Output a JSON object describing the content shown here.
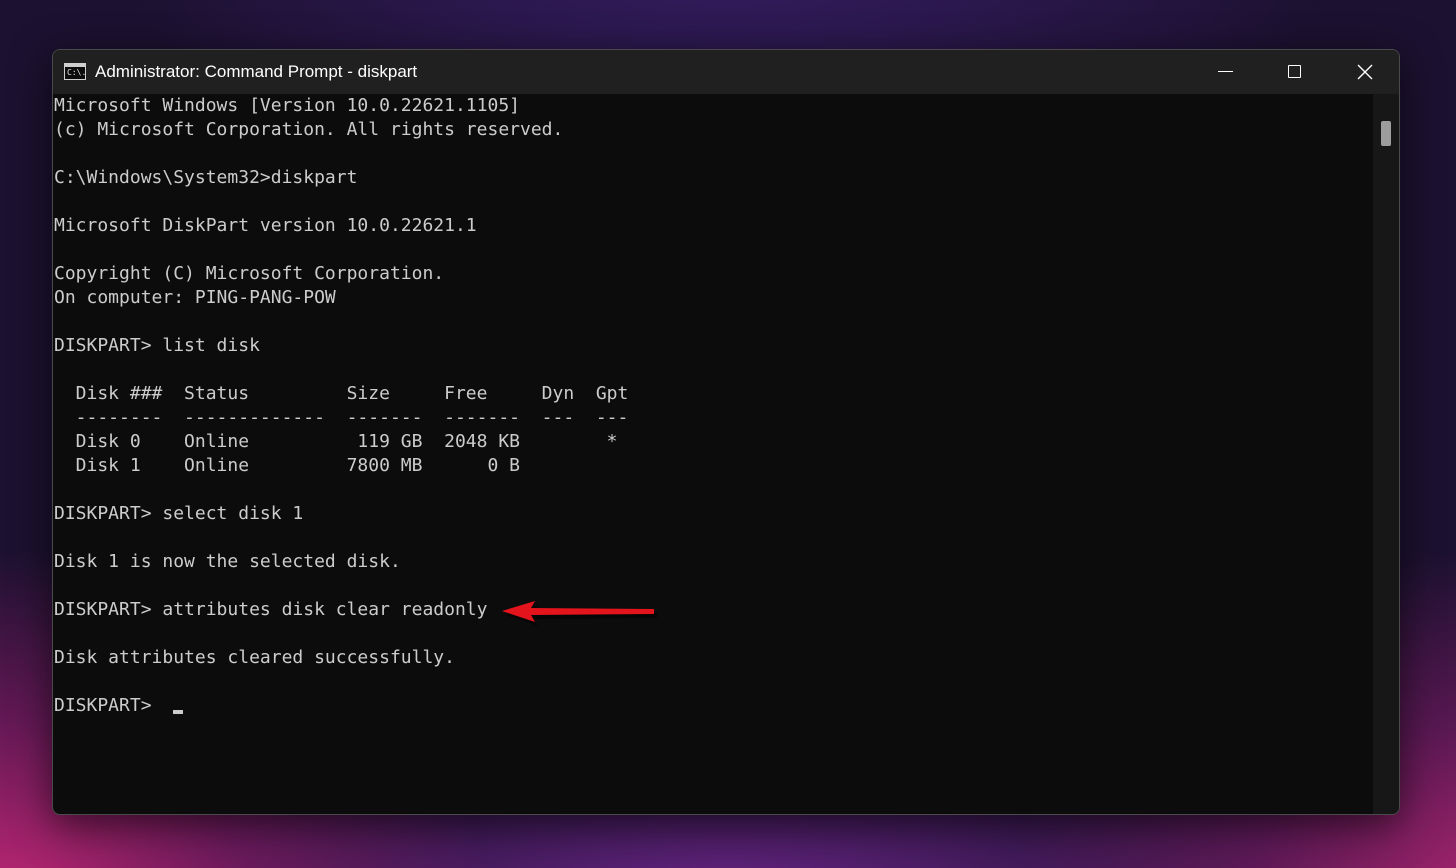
{
  "window": {
    "title": "Administrator: Command Prompt - diskpart",
    "icon": "cmd-icon",
    "icon_glyph": "C:\\.",
    "controls": [
      "minimize-icon",
      "maximize-icon",
      "close-icon"
    ]
  },
  "console": {
    "lines": [
      "Microsoft Windows [Version 10.0.22621.1105]",
      "(c) Microsoft Corporation. All rights reserved.",
      "",
      "C:\\Windows\\System32>diskpart",
      "",
      "Microsoft DiskPart version 10.0.22621.1",
      "",
      "Copyright (C) Microsoft Corporation.",
      "On computer: PING-PANG-POW",
      "",
      "DISKPART> list disk",
      "",
      "  Disk ###  Status         Size     Free     Dyn  Gpt",
      "  --------  -------------  -------  -------  ---  ---",
      "  Disk 0    Online          119 GB  2048 KB        *",
      "  Disk 1    Online         7800 MB      0 B",
      "",
      "DISKPART> select disk 1",
      "",
      "Disk 1 is now the selected disk.",
      "",
      "DISKPART> attributes disk clear readonly",
      "",
      "Disk attributes cleared successfully.",
      "",
      "DISKPART> "
    ]
  },
  "colors": {
    "console_background": "#0c0c0c",
    "console_text": "#cccccc",
    "titlebar": "#202020",
    "annotation_arrow": "#e3141c"
  },
  "annotation": {
    "icon": "red-arrow-icon"
  }
}
